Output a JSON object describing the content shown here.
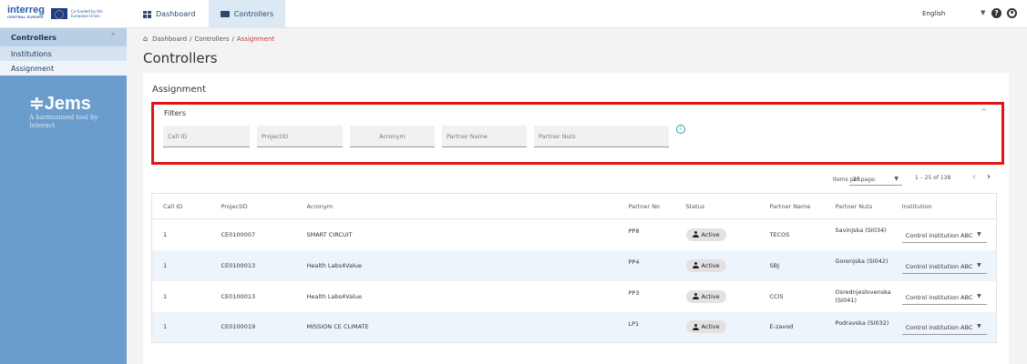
{
  "header": {
    "logo_line1": "interreg",
    "logo_line2": "CENTRAL EUROPE",
    "eu_text": "Co-funded by the European Union",
    "tabs": [
      {
        "label": "Dashboard"
      },
      {
        "label": "Controllers"
      }
    ],
    "language": "English"
  },
  "sidebar": {
    "section": "Controllers",
    "items": [
      {
        "label": "Institutions"
      },
      {
        "label": "Assignment"
      }
    ],
    "brand": "Jems",
    "tagline": "A harmonised tool by Interact"
  },
  "breadcrumb": {
    "items": [
      "Dashboard",
      "Controllers"
    ],
    "current": "Assignment",
    "separator": "/"
  },
  "page_title": "Controllers",
  "card_title": "Assignment",
  "filters": {
    "title": "Filters",
    "fields": [
      {
        "placeholder": "Call ID"
      },
      {
        "placeholder": "ProjectID"
      },
      {
        "placeholder": "Acronym"
      },
      {
        "placeholder": "Partner Name"
      },
      {
        "placeholder": "Partner Nuts"
      }
    ]
  },
  "paginator": {
    "label": "Items per page:",
    "page_size": "25",
    "range": "1 – 25 of 138"
  },
  "table": {
    "columns": [
      "Call ID",
      "ProjectID",
      "Acronym",
      "Partner No",
      "Status",
      "Partner Name",
      "Partner Nuts",
      "Institution"
    ],
    "rows": [
      {
        "call_id": "1",
        "project_id": "CE0100007",
        "acronym": "SMART CIRCUIT",
        "partner_no": "PP8",
        "status": "Active",
        "partner_name": "TECOS",
        "partner_nuts": "Savinjska (SI034)",
        "institution": "Control institution ABC"
      },
      {
        "call_id": "1",
        "project_id": "CE0100013",
        "acronym": "Health Labs4Value",
        "partner_no": "PP4",
        "status": "Active",
        "partner_name": "SBJ",
        "partner_nuts": "Gorenjska (SI042)",
        "institution": "Control institution ABC"
      },
      {
        "call_id": "1",
        "project_id": "CE0100013",
        "acronym": "Health Labs4Value",
        "partner_no": "PP3",
        "status": "Active",
        "partner_name": "CCIS",
        "partner_nuts": "Osrednjeslovenska (SI041)",
        "institution": "Control institution ABC"
      },
      {
        "call_id": "1",
        "project_id": "CE0100019",
        "acronym": "MISSION CE CLIMATE",
        "partner_no": "LP1",
        "status": "Active",
        "partner_name": "E-zavod",
        "partner_nuts": "Podravska (SI032)",
        "institution": "Control institution ABC"
      }
    ]
  },
  "colors": {
    "sidebar": "#6a9ccc",
    "highlight": "#e0161b",
    "active_tab": "#dce9f5",
    "row_alt": "#eef4fb"
  }
}
